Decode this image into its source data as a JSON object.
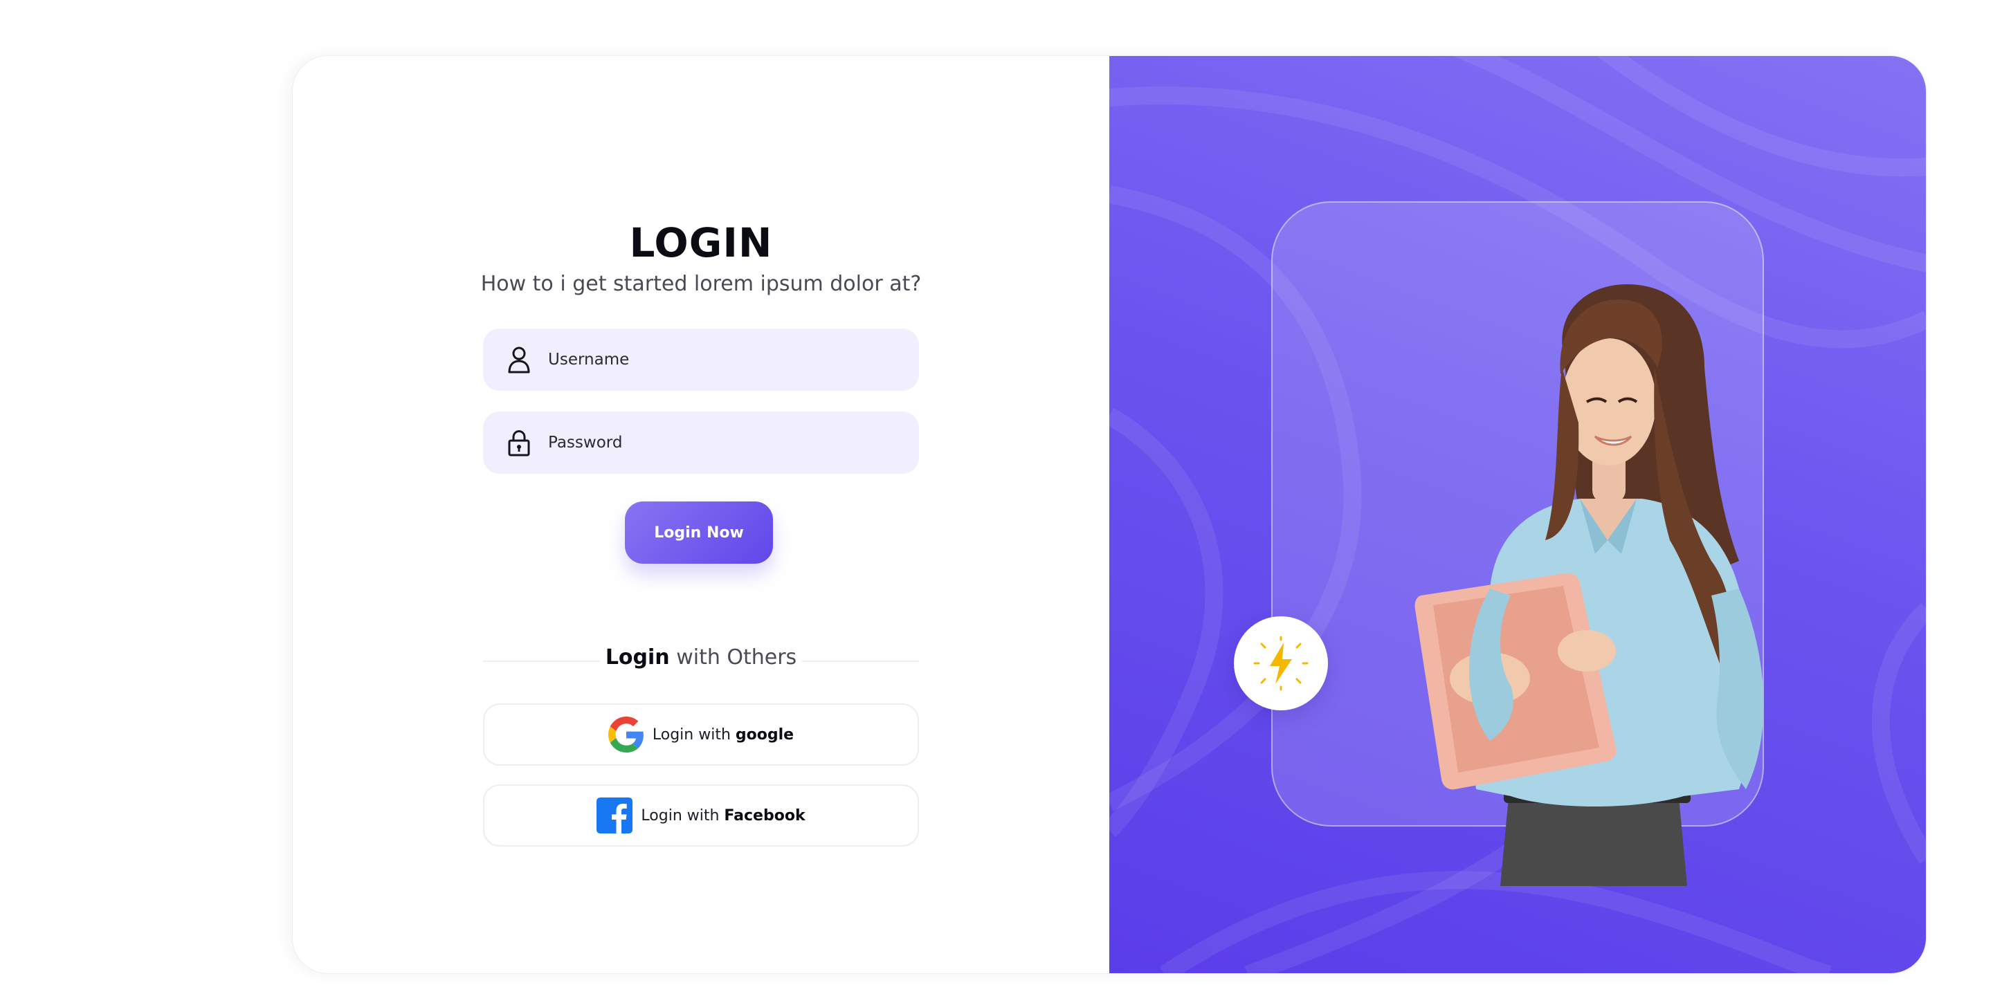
{
  "login": {
    "title": "LOGIN",
    "subtitle": "How to i get started lorem ipsum dolor at?",
    "username_placeholder": "Username",
    "password_placeholder": "Password",
    "submit_label": "Login Now",
    "divider_bold": "Login",
    "divider_rest": " with Others",
    "google_prefix": "Login with ",
    "google_brand": "google",
    "facebook_prefix": "Login with ",
    "facebook_brand": "Facebook"
  },
  "colors": {
    "accent": "#6046ea",
    "accent_light": "#8974f2",
    "input_bg": "#f1effd",
    "panel_gradient_top": "#8472f4",
    "panel_gradient_bottom": "#5a3de9",
    "badge_icon": "#f5b800"
  },
  "icons": {
    "username": "user-icon",
    "password": "lock-icon",
    "google": "google-logo",
    "facebook": "facebook-logo",
    "badge": "lightning-icon"
  }
}
